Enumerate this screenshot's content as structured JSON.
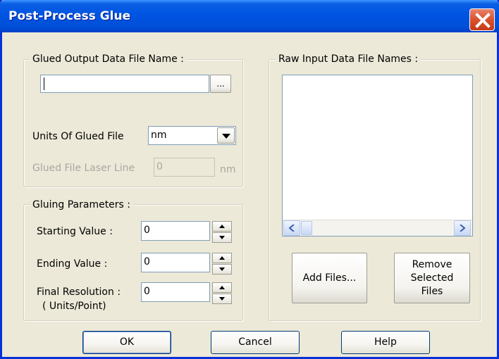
{
  "window": {
    "title": "Post-Process Glue"
  },
  "output_group": {
    "legend": "Glued Output Data File Name :",
    "filename_value": "",
    "browse_label": "...",
    "units_label": "Units Of Glued File",
    "units_selected": "nm",
    "laser_label": "Glued File Laser Line",
    "laser_value": "0",
    "laser_unit": "nm"
  },
  "gluing_group": {
    "legend": "Gluing Parameters :",
    "starting_label": "Starting Value :",
    "starting_value": "0",
    "ending_label": "Ending Value :",
    "ending_value": "0",
    "resolution_label": "Final Resolution :",
    "resolution_units": "( Units/Point)",
    "resolution_value": "0"
  },
  "raw_group": {
    "legend": "Raw Input Data File Names :",
    "files": [],
    "add_label": "Add Files...",
    "remove_line1": "Remove",
    "remove_line2": "Selected",
    "remove_line3": "Files"
  },
  "buttons": {
    "ok": "OK",
    "cancel": "Cancel",
    "help": "Help"
  },
  "colors": {
    "titlebar": "#0054e3",
    "face": "#ece9d8",
    "close": "#d9512c"
  },
  "icons": {
    "close": "close-icon",
    "dropdown": "chevron-down-icon",
    "spin_up": "spin-up-icon",
    "spin_down": "spin-down-icon",
    "scroll_left": "arrow-left-icon",
    "scroll_right": "arrow-right-icon"
  }
}
